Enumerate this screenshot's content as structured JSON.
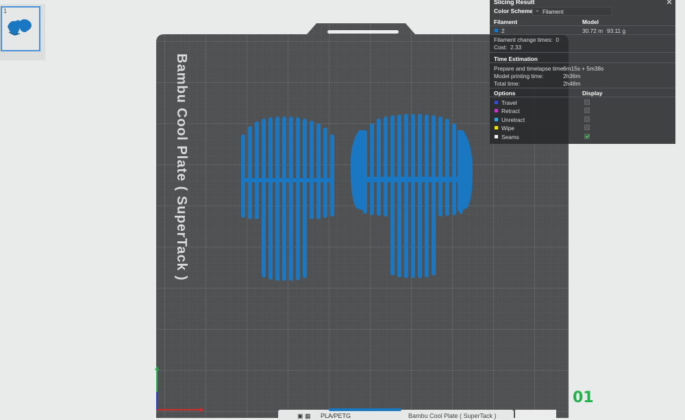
{
  "plate_list": {
    "items": [
      {
        "number": "1"
      }
    ]
  },
  "plate": {
    "label": "Bambu Cool Plate ( SuperTack )",
    "number": "01"
  },
  "bottom_bar": {
    "material": "PLA/PETG",
    "plate_name": "Bambu Cool Plate ( SuperTack )"
  },
  "slicing_result": {
    "title": "Slicing Result",
    "color_scheme": {
      "label": "Color Scheme",
      "value": "Filament"
    },
    "headers": {
      "filament": "Filament",
      "model": "Model"
    },
    "filament_row": {
      "id": "2",
      "length": "30.72 m",
      "weight": "93.11 g"
    },
    "filament_change": {
      "label": "Filament change times:",
      "value": "0"
    },
    "cost": {
      "label": "Cost:",
      "value": "2.33"
    },
    "time_estimation": {
      "title": "Time Estimation",
      "rows": [
        {
          "label": "Prepare and timelapse time:",
          "value": "6m15s + 5m38s"
        },
        {
          "label": "Model printing time:",
          "value": "2h36m"
        },
        {
          "label": "Total time:",
          "value": "2h48m"
        }
      ]
    },
    "options": {
      "title": "Options",
      "display_title": "Display",
      "items": [
        {
          "label": "Travel",
          "color": "#3a4cc4",
          "checked": false
        },
        {
          "label": "Retract",
          "color": "#c23ac4",
          "checked": false
        },
        {
          "label": "Unretract",
          "color": "#3aa6d9",
          "checked": false
        },
        {
          "label": "Wipe",
          "color": "#f2e600",
          "checked": false
        },
        {
          "label": "Seams",
          "color": "#f0f0f0",
          "checked": true
        }
      ]
    }
  },
  "colors": {
    "filament": "#1a78c2",
    "plate": "#505152",
    "grid": "#6a6b6c",
    "panel": "#28292a"
  }
}
